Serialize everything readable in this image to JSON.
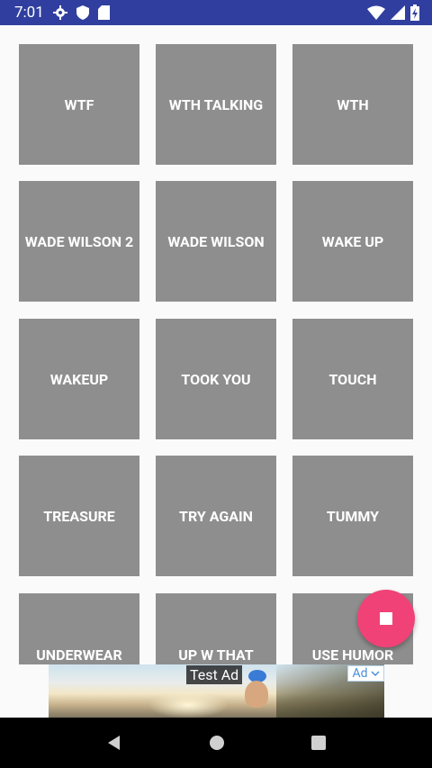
{
  "status_bar": {
    "time": "7:01",
    "icons": [
      "gear-icon",
      "shield-icon",
      "sd-card-icon",
      "wifi-icon",
      "signal-icon",
      "battery-charging-icon"
    ]
  },
  "tiles": [
    {
      "label": "WTF"
    },
    {
      "label": "WTH TALKING"
    },
    {
      "label": "WTH"
    },
    {
      "label": "WADE WILSON 2"
    },
    {
      "label": "WADE WILSON"
    },
    {
      "label": "WAKE UP"
    },
    {
      "label": "WAKEUP"
    },
    {
      "label": "TOOK YOU"
    },
    {
      "label": "TOUCH"
    },
    {
      "label": "TREASURE"
    },
    {
      "label": "TRY AGAIN"
    },
    {
      "label": "TUMMY"
    },
    {
      "label": "UNDERWEAR"
    },
    {
      "label": "UP W THAT"
    },
    {
      "label": "USE HUMOR"
    }
  ],
  "ad": {
    "title": "Test Ad",
    "badge": "Ad"
  },
  "fab": {
    "icon": "stop-icon",
    "color": "#f04276"
  },
  "nav_bar": {
    "icons": [
      "back-icon",
      "home-icon",
      "recents-icon"
    ]
  },
  "colors": {
    "status_bar": "#303f9f",
    "tile": "#8e8e8e",
    "fab": "#f04276"
  }
}
